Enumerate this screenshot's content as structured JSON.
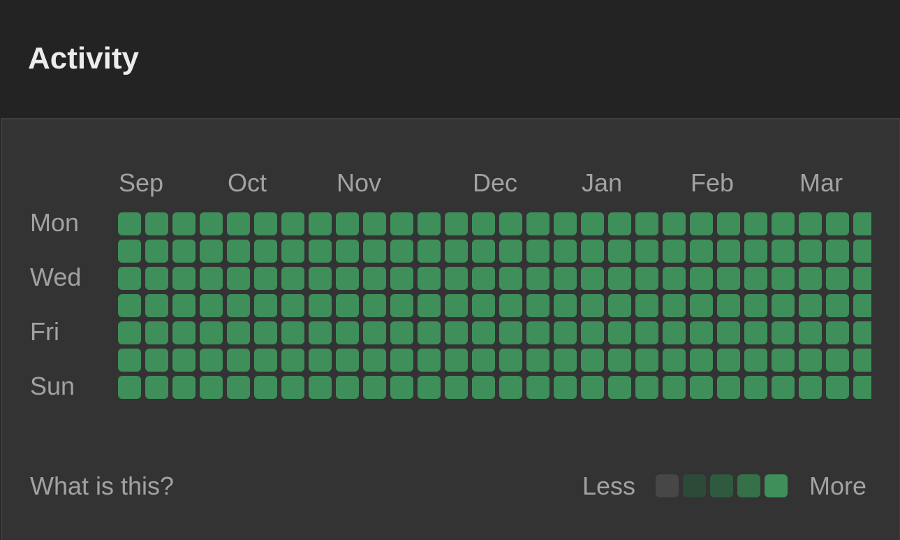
{
  "header": {
    "title": "Activity"
  },
  "heatmap": {
    "months": [
      "Sep",
      "Oct",
      "Nov",
      "Dec",
      "Jan",
      "Feb",
      "Mar"
    ],
    "day_labels": [
      "Mon",
      "Wed",
      "Fri",
      "Sun"
    ],
    "weeks_shown": 28,
    "days_per_week": 7,
    "cell_level": 4
  },
  "footer": {
    "help_link": "What is this?",
    "legend_less": "Less",
    "legend_more": "More"
  },
  "colors": {
    "level_0": "#474747",
    "level_1": "#2c4a38",
    "level_2": "#2f5a3f",
    "level_3": "#357048",
    "level_4": "#3e8f5a"
  }
}
